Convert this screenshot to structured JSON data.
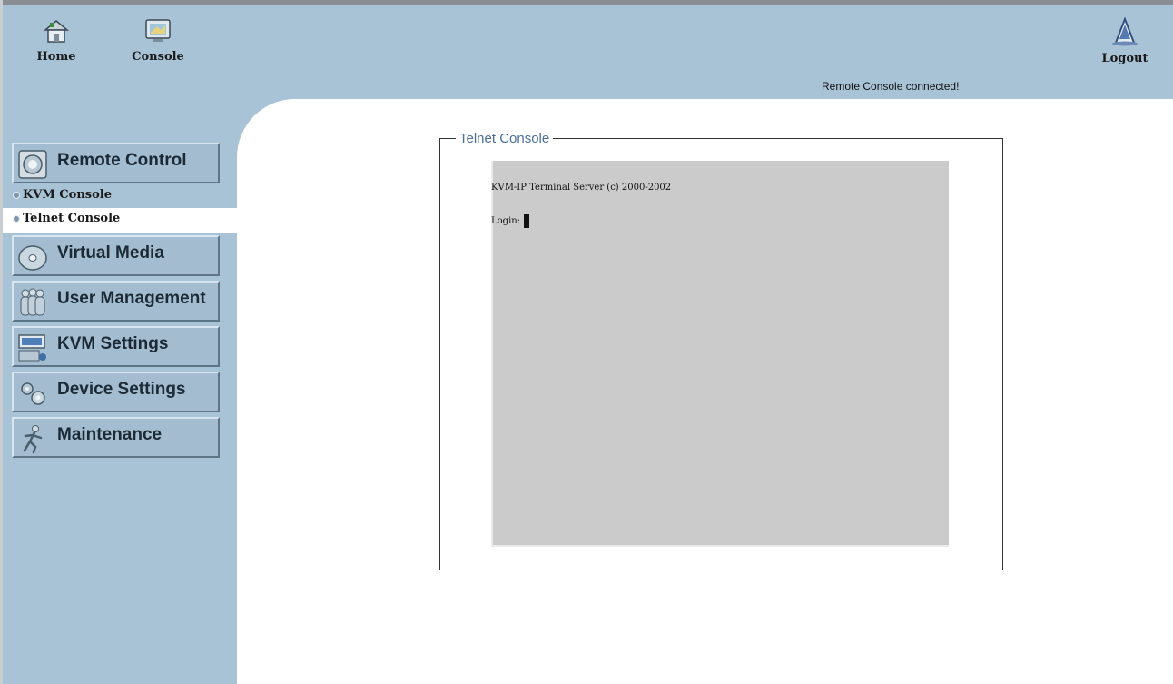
{
  "topbar": {
    "home": {
      "label": "Home",
      "icon": "home-icon"
    },
    "console": {
      "label": "Console",
      "icon": "monitor-icon"
    },
    "status": "Remote Console connected!",
    "logout": {
      "label": "Logout",
      "icon": "logout-icon"
    }
  },
  "sidebar": {
    "remote_control": "Remote Control",
    "kvm_console": "KVM Console",
    "telnet_console": "Telnet Console",
    "virtual_media": "Virtual Media",
    "user_management": "User Management",
    "kvm_settings": "KVM Settings",
    "device_settings": "Device Settings",
    "maintenance": "Maintenance"
  },
  "main": {
    "legend": "Telnet Console",
    "terminal": {
      "line1": "KVM-IP Terminal Server (c) 2000-2002",
      "line2": "Login:"
    }
  },
  "colors": {
    "panel": "#a9c3d6",
    "legend": "#4a6e9c",
    "terminal_bg": "#cbcbcb"
  }
}
